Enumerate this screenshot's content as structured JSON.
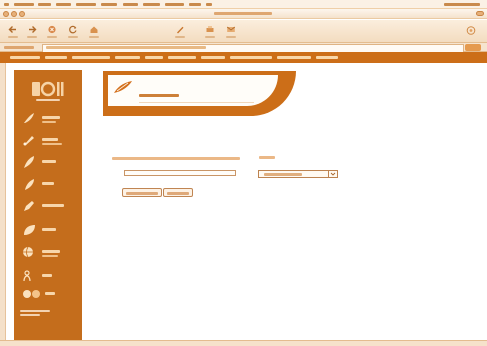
{
  "colors": {
    "accent": "#cc6e18",
    "sidebar": "#c46d1c",
    "chrome": "#f5e2cc",
    "text_tint": "#8a4a12"
  },
  "menubar": {
    "icons": [
      "apple-icon"
    ],
    "items": [
      {
        "label": ""
      },
      {
        "label": ""
      },
      {
        "label": ""
      },
      {
        "label": ""
      },
      {
        "label": ""
      },
      {
        "label": ""
      },
      {
        "label": ""
      },
      {
        "label": ""
      },
      {
        "label": ""
      },
      {
        "label": ""
      }
    ],
    "clock": ""
  },
  "window": {
    "title": ""
  },
  "toolbar": {
    "buttons": [
      {
        "icon": "back-arrow-icon",
        "label": ""
      },
      {
        "icon": "forward-arrow-icon",
        "label": ""
      },
      {
        "icon": "stop-icon",
        "label": ""
      },
      {
        "icon": "refresh-icon",
        "label": ""
      },
      {
        "icon": "home-icon",
        "label": ""
      },
      {
        "icon": "autofill-icon",
        "label": ""
      },
      {
        "icon": "print-icon",
        "label": ""
      },
      {
        "icon": "mail-icon",
        "label": ""
      }
    ]
  },
  "address": {
    "label": "",
    "url": "",
    "go_label": ""
  },
  "site_nav": {
    "links": [
      {
        "label": ""
      },
      {
        "label": ""
      },
      {
        "label": ""
      },
      {
        "label": ""
      },
      {
        "label": ""
      },
      {
        "label": ""
      },
      {
        "label": ""
      },
      {
        "label": ""
      },
      {
        "label": ""
      },
      {
        "label": ""
      }
    ]
  },
  "sidebar": {
    "logo": "",
    "items": [
      {
        "icon": "feather-icon",
        "label": ""
      },
      {
        "icon": "pen-icon",
        "label": ""
      },
      {
        "icon": "quill-icon",
        "label": ""
      },
      {
        "icon": "quill-icon",
        "label": ""
      },
      {
        "icon": "pencil-icon",
        "label": ""
      },
      {
        "icon": "leaf-icon",
        "label": ""
      },
      {
        "icon": "globe-icon",
        "label": ""
      },
      {
        "icon": "people-icon",
        "label": ""
      },
      {
        "icon": "group-icon",
        "label": ""
      }
    ],
    "footer": ""
  },
  "content": {
    "banner_icon": "quill-icon",
    "title": "",
    "subtitle": "",
    "form": {
      "field_label": "",
      "select_label": "",
      "text_value": "",
      "select_value": "",
      "submit_label": "",
      "reset_label": ""
    }
  }
}
